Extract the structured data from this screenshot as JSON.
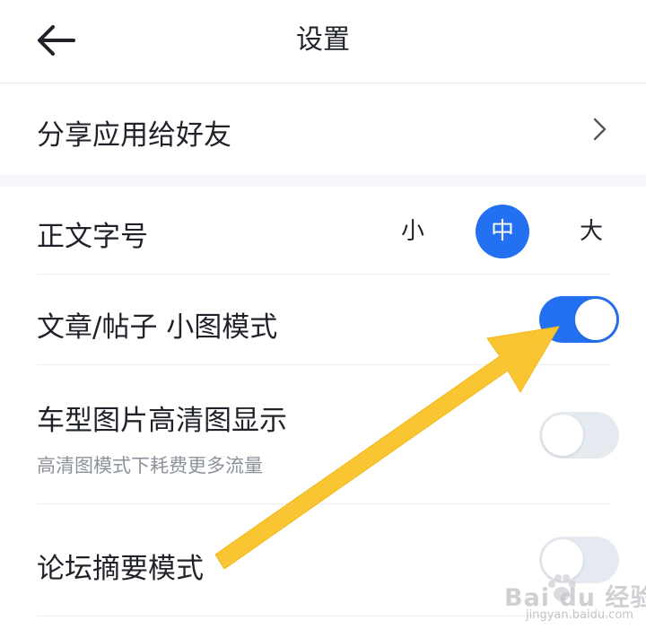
{
  "header": {
    "title": "设置"
  },
  "share": {
    "label": "分享应用给好友"
  },
  "font_size": {
    "label": "正文字号",
    "options": [
      "小",
      "中",
      "大"
    ],
    "selected": "中"
  },
  "small_image_mode": {
    "label": "文章/帖子 小图模式",
    "enabled": true
  },
  "hd_image": {
    "label": "车型图片高清图显示",
    "sublabel": "高清图模式下耗费更多流量",
    "enabled": false
  },
  "forum_summary": {
    "label": "论坛摘要模式",
    "enabled": false
  },
  "watermark": {
    "brand": "Bai du 经验",
    "url": "jingyan.baidu.com"
  },
  "colors": {
    "accent": "#2470f2",
    "toggle_off": "#e5e9f0",
    "arrow": "#f9c532",
    "text": "#1f2329",
    "subtext": "#8c929c"
  }
}
